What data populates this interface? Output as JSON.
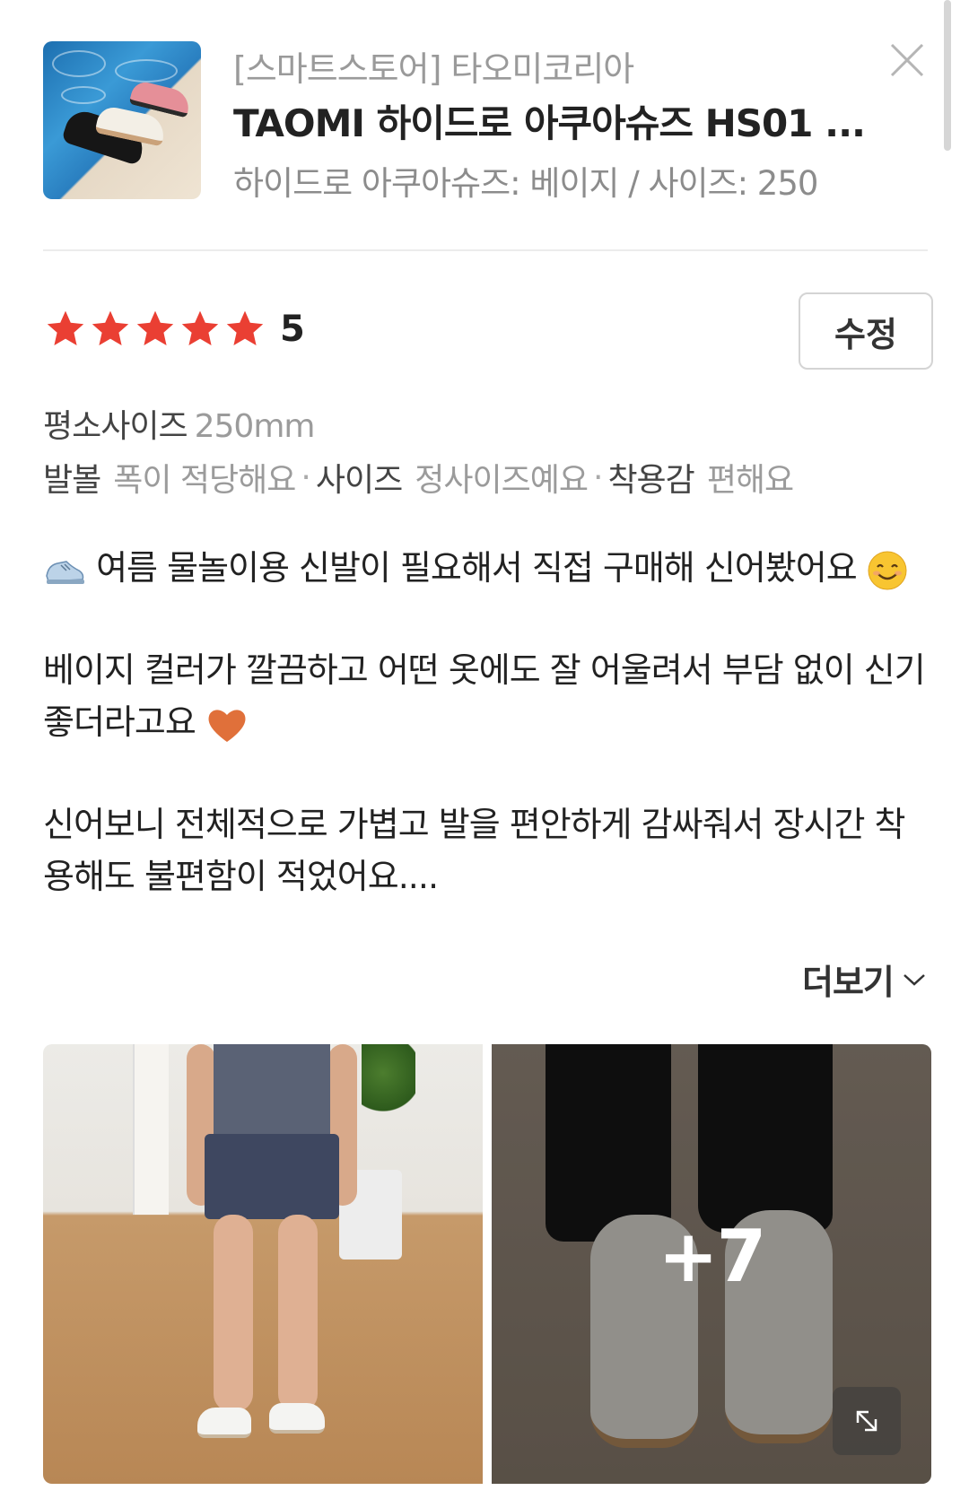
{
  "product": {
    "store": "[스마트스토어] 타오미코리아",
    "title": "TAOMI 하이드로 아쿠아슈즈 HS01 ...",
    "option": "하이드로 아쿠아슈즈: 베이지 / 사이즈: 250"
  },
  "rating": {
    "stars": 5,
    "max_stars": 5,
    "score": "5",
    "star_color": "#ea3f33",
    "edit_label": "수정"
  },
  "size": {
    "label": "평소사이즈",
    "value": "250mm"
  },
  "attributes": [
    {
      "label": "발볼",
      "value": "폭이 적당해요"
    },
    {
      "label": "사이즈",
      "value": "정사이즈예요"
    },
    {
      "label": "착용감",
      "value": "편해요"
    }
  ],
  "review": {
    "line1": "여름 물놀이용 신발이 필요해서 직접 구매해 신어봤어요",
    "line2": "베이지 컬러가 깔끔하고 어떤 옷에도 잘 어울려서 부담 없이 신기 좋더라고요",
    "line3": "신어보니 전체적으로 가볍고 발을 편안하게 감싸줘서 장시간 착용해도 불편함이 적었어요...."
  },
  "more_label": "더보기",
  "photos": {
    "extra_count": "+7"
  },
  "icons": {
    "close": "close-icon",
    "star": "star-icon",
    "chevron": "chevron-down-icon",
    "expand": "expand-icon",
    "shoe_emoji": "running-shoe-icon",
    "smile_emoji": "smiling-face-icon",
    "heart_emoji": "orange-heart-icon"
  }
}
